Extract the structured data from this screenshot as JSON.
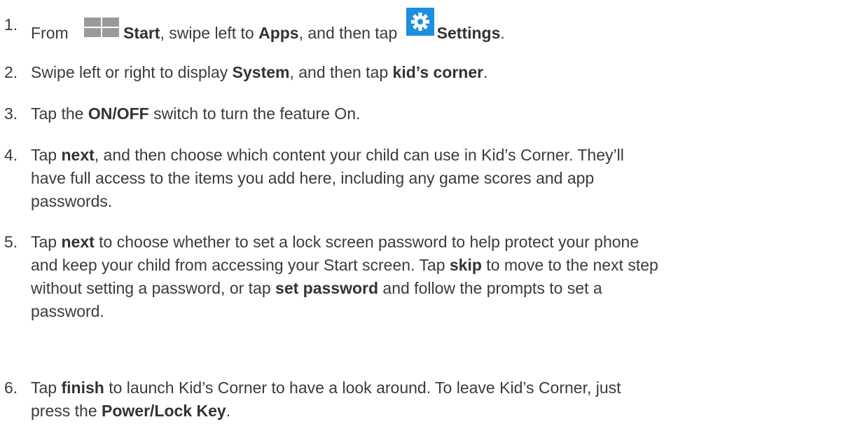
{
  "steps": [
    {
      "number": "1.",
      "parts": [
        {
          "t": "From "
        },
        {
          "icon": "windows-start-icon"
        },
        {
          "t": "Start",
          "b": true
        },
        {
          "t": ", swipe left to "
        },
        {
          "t": "Apps",
          "b": true
        },
        {
          "t": ", and then tap "
        },
        {
          "icon": "settings-gear-icon"
        },
        {
          "t": "Settings",
          "b": true
        },
        {
          "t": "."
        }
      ]
    },
    {
      "number": "2.",
      "parts": [
        {
          "t": "Swipe left or right to display "
        },
        {
          "t": "System",
          "b": true
        },
        {
          "t": ", and then tap "
        },
        {
          "t": "kid’s corner",
          "b": true
        },
        {
          "t": "."
        }
      ]
    },
    {
      "number": "3.",
      "parts": [
        {
          "t": "Tap the "
        },
        {
          "t": "ON/OFF",
          "b": true
        },
        {
          "t": " switch to turn the feature On."
        }
      ]
    },
    {
      "number": "4.",
      "parts": [
        {
          "t": "Tap "
        },
        {
          "t": "next",
          "b": true
        },
        {
          "t": ", and then choose which content your child can use in Kid’s Corner. They’ll "
        },
        {
          "br": true
        },
        {
          "t": "have full access to the items you add here, including any game scores and app "
        },
        {
          "br": true
        },
        {
          "t": "passwords."
        }
      ]
    },
    {
      "number": "5.",
      "parts": [
        {
          "t": "Tap "
        },
        {
          "t": "next",
          "b": true
        },
        {
          "t": " to choose whether to set a lock screen password to help protect your phone "
        },
        {
          "br": true
        },
        {
          "t": "and keep your child from accessing your Start screen. Tap "
        },
        {
          "t": "skip",
          "b": true
        },
        {
          "t": " to move to the next step "
        },
        {
          "br": true
        },
        {
          "t": "without setting a password, or tap "
        },
        {
          "t": "set password",
          "b": true
        },
        {
          "t": " and follow the prompts to set a "
        },
        {
          "br": true
        },
        {
          "t": "password."
        }
      ]
    },
    {
      "number": "6.",
      "parts": [
        {
          "t": "Tap "
        },
        {
          "t": "finish",
          "b": true
        },
        {
          "t": " to launch Kid’s Corner to have a look around. To leave Kid’s Corner, just "
        },
        {
          "br": true
        },
        {
          "t": "press the "
        },
        {
          "t": "Power/Lock Key",
          "b": true
        },
        {
          "t": "."
        }
      ]
    }
  ],
  "colors": {
    "text": "#3b3b3b",
    "windows_tile": "#9a9a9a",
    "settings_tile": "#1c8fe0"
  }
}
